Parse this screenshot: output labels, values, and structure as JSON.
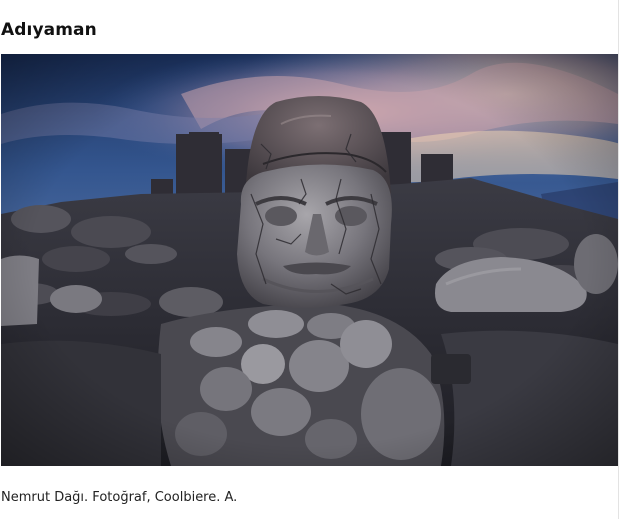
{
  "article": {
    "title": "Adıyaman",
    "caption": "Nemrut Dağı. Fotoğraf, Coolbiere. A."
  },
  "photo": {
    "subject": "stone-head-statue",
    "palette": {
      "sky_top": "#1d3768",
      "sky_mid": "#3a5d9a",
      "cloud_pink": "#d7a3a8",
      "cloud_gold": "#e8c9a0",
      "rock_dark": "#2a2a31",
      "rock_mid": "#4a4a52",
      "stone_light": "#8f8e94"
    }
  }
}
